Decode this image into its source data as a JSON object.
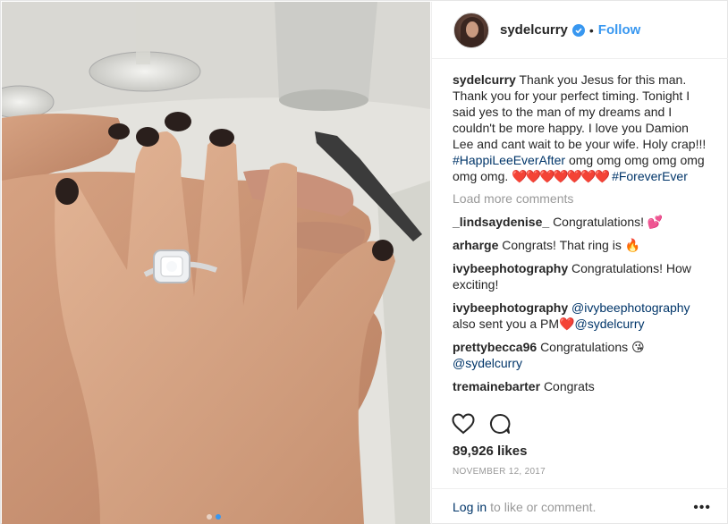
{
  "post": {
    "username": "sydelcurry",
    "separator": "•",
    "follow_label": "Follow",
    "caption": {
      "user": "sydelcurry",
      "text": "Thank you Jesus for this man. Thank you for your perfect timing. Tonight I said yes to the man of my dreams and I couldn't be more happy. I love you Damion Lee and cant wait to be your wife. Holy crap!!!",
      "hashtag1": "#HappiLeeEverAfter",
      "text2": "omg omg omg omg omg omg omg.",
      "hearts": "❤️❤️❤️❤️❤️❤️❤️",
      "hashtag2": "#ForeverEver"
    },
    "load_more_label": "Load more comments",
    "comments": [
      {
        "user": "_lindsaydenise_",
        "text": "Congratulations!",
        "emoji": "💕"
      },
      {
        "user": "arharge",
        "text": "Congrats! That ring is",
        "emoji": "🔥"
      },
      {
        "user": "ivybeephotography",
        "text": "Congratulations! How exciting!"
      },
      {
        "user": "ivybeephotography",
        "mention1": "@ivybeephotography",
        "text": "also sent you a PM",
        "emoji": "❤️",
        "mention2": "@sydelcurry"
      },
      {
        "user": "prettybecca96",
        "text": "Congratulations",
        "emoji": "😘",
        "mention": "@sydelcurry"
      },
      {
        "user": "tremainebarter",
        "text": "Congrats"
      }
    ],
    "likes": "89,926 likes",
    "date": "NOVEMBER 12, 2017",
    "footer": {
      "login_label": "Log in",
      "text": "to like or comment.",
      "more_label": "•••"
    },
    "carousel": {
      "count": 2,
      "active": 2
    }
  },
  "colors": {
    "link": "#3897f0",
    "mention": "#003569",
    "muted": "#999999",
    "text": "#262626"
  },
  "icons": {
    "verified": "verified-badge-icon",
    "like": "heart-outline-icon",
    "comment": "speech-bubble-icon",
    "more": "more-options-icon"
  }
}
